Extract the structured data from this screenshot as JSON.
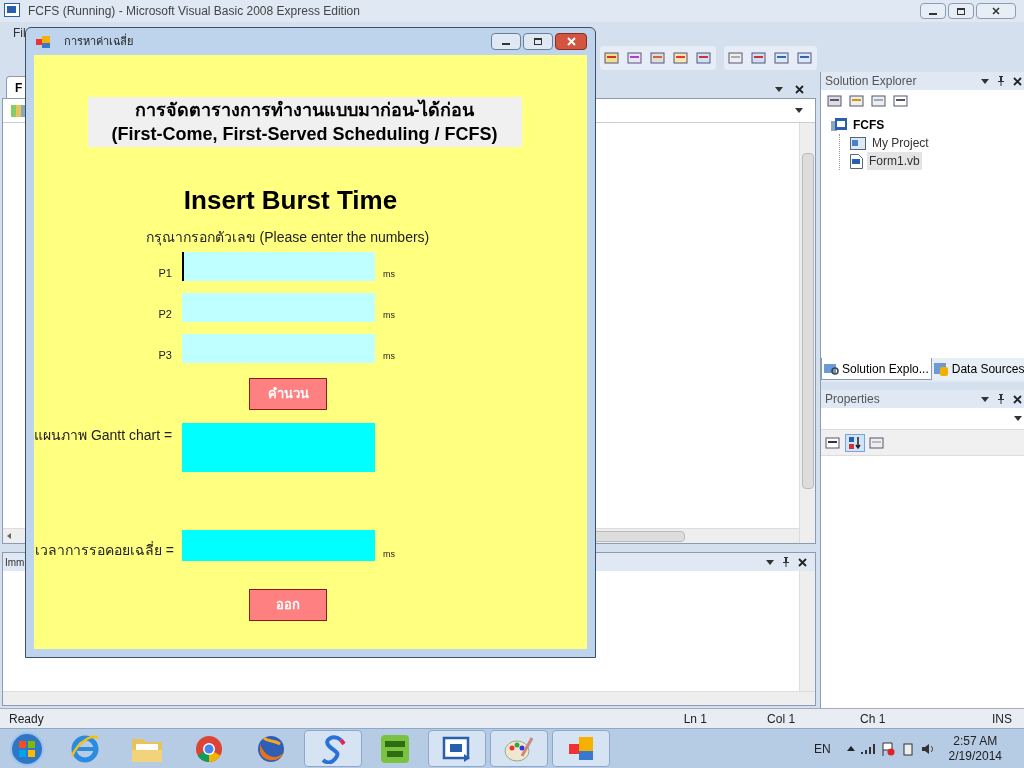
{
  "ide": {
    "title": "FCFS (Running) - Microsoft Visual Basic 2008 Express Edition",
    "menu": [
      "Fil"
    ],
    "document_tab": "F",
    "output_panel": {
      "title": "Imm"
    },
    "solution_explorer": {
      "title": "Solution Explorer",
      "tree": [
        {
          "label": "FCFS",
          "kind": "solution",
          "selected": false,
          "children": [
            {
              "label": "My Project",
              "kind": "project",
              "selected": false
            },
            {
              "label": "Form1.vb",
              "kind": "file",
              "selected": true
            }
          ]
        }
      ]
    },
    "panel_tabs": [
      {
        "label": "Solution Explo...",
        "kind": "explorer",
        "selected": true
      },
      {
        "label": "Data Sources",
        "kind": "data",
        "selected": false
      }
    ],
    "properties": {
      "title": "Properties"
    },
    "status_bar": {
      "status": "Ready",
      "line": "Ln 1",
      "column": "Col 1",
      "char": "Ch 1",
      "mode": "INS"
    }
  },
  "dialog": {
    "title": "การหาค่าเฉลี่ย",
    "heading": [
      "การจัดตารางการทำงานแบบมาก่อน-ได้ก่อน",
      "(First-Come, First-Served Scheduling / FCFS)"
    ],
    "subheading": "Insert Burst Time",
    "instruction": "กรุณากรอกตัวเลข (Please enter the numbers)",
    "inputs": [
      {
        "label": "P1",
        "unit": "ms",
        "focused": true
      },
      {
        "label": "P2",
        "unit": "ms",
        "focused": false
      },
      {
        "label": "P3",
        "unit": "ms",
        "focused": false
      }
    ],
    "calculate_button": "คำนวน",
    "gantt": {
      "label": "แผนภาพ Gantt chart ="
    },
    "average_wait": {
      "label": "เวลาการรอคอยเฉลี่ย =",
      "unit": "ms"
    },
    "exit_button": "ออก"
  },
  "taskbar": {
    "apps": [
      {
        "kind": "browser-e",
        "open": false
      },
      {
        "kind": "folder",
        "open": false
      },
      {
        "kind": "chrome",
        "open": false
      },
      {
        "kind": "fox",
        "open": false
      },
      {
        "kind": "swirl",
        "open": true
      },
      {
        "kind": "hao",
        "open": false
      },
      {
        "kind": "vb",
        "open": true
      },
      {
        "kind": "palette",
        "open": true
      },
      {
        "kind": "form",
        "open": true
      }
    ],
    "language": "EN",
    "time": "2:57 AM",
    "date": "2/19/2014"
  }
}
